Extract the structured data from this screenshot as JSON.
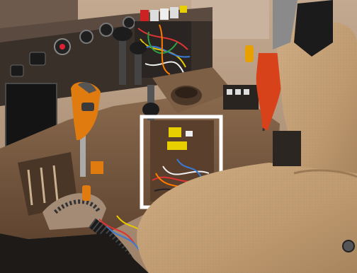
{
  "image": {
    "subject": "tractor-cab-console-with-highlighted-wiring",
    "highlight": {
      "frame_color": "#ffffff"
    },
    "palette": {
      "console_brown": "#7a5a40",
      "dark_panel": "#2d2723",
      "lever_orange": "#e07b10",
      "accent_red": "#d8421a",
      "switch_yellow": "#e8d000",
      "seat_fabric": "#c5a178",
      "background_wall": "#b59a7f"
    }
  }
}
